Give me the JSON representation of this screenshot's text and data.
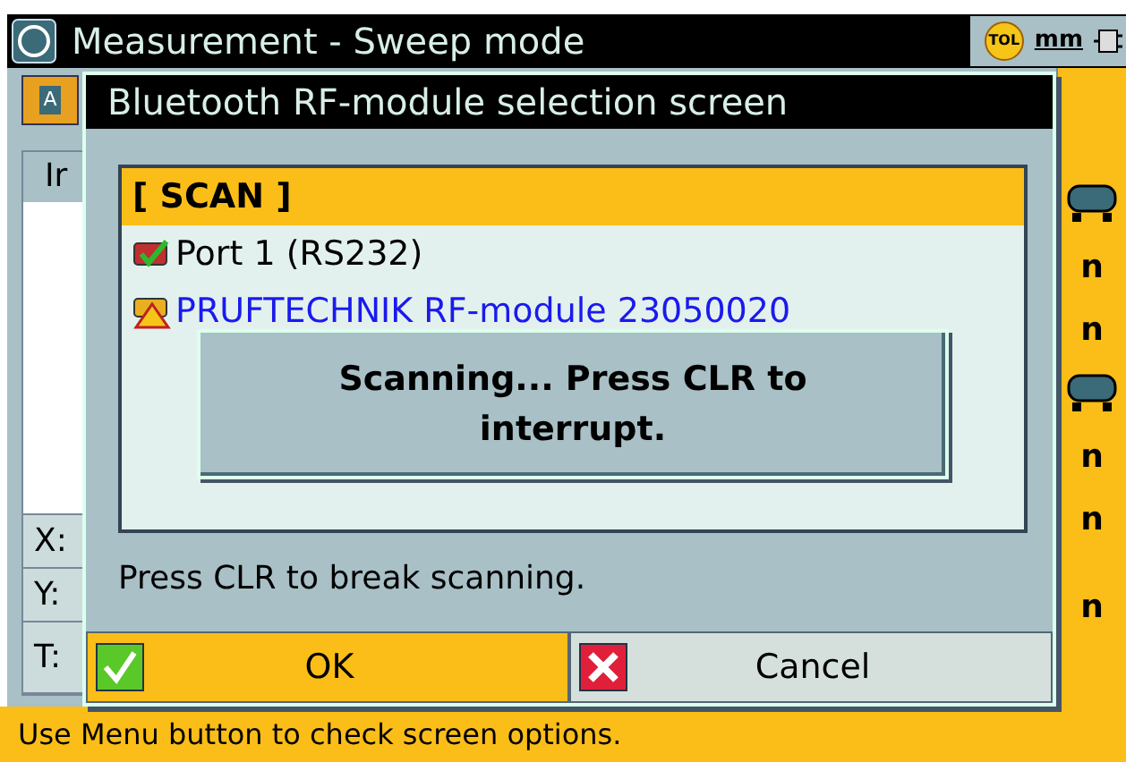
{
  "window": {
    "title": "Measurement - Sweep mode"
  },
  "status_icons": {
    "tolerance": "TOL",
    "unit": "mm"
  },
  "toolbar": {
    "icon_letter": "A"
  },
  "background": {
    "left_labels": [
      "Ir",
      "X:",
      "Y:",
      "T:"
    ],
    "right_labels": [
      "n",
      "n",
      "n",
      "n",
      "n"
    ]
  },
  "dialog": {
    "title": "Bluetooth RF-module selection screen",
    "items": [
      {
        "label": "[ SCAN ]",
        "kind": "action",
        "selected": true
      },
      {
        "label": "Port 1 (RS232)",
        "kind": "port",
        "selected": false
      },
      {
        "label": "PRUFTECHNIK RF-module 23050020",
        "kind": "module",
        "selected": false
      }
    ],
    "popup": "Scanning... Press CLR to interrupt.",
    "message": "Press CLR to break scanning.",
    "buttons": [
      {
        "label": "OK",
        "kind": "ok",
        "selected": true
      },
      {
        "label": "Cancel",
        "kind": "cancel",
        "selected": false
      }
    ]
  },
  "status_bar": "Use Menu button to check screen options."
}
